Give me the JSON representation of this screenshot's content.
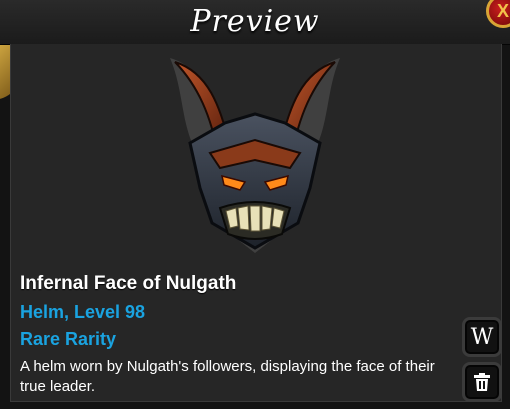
{
  "window": {
    "title": "Preview",
    "close_glyph": "X"
  },
  "item": {
    "name": "Infernal Face of Nulgath",
    "type_level": "Helm, Level 98",
    "rarity": "Rare Rarity",
    "description": "A helm worn by Nulgath's followers, displaying the face of their true leader."
  },
  "buttons": {
    "wiki_label": "W",
    "delete_icon": "trash-icon"
  },
  "colors": {
    "accent_blue": "#1aa3e0",
    "panel_bg": "#262626",
    "close_red": "#c81e1e",
    "gold": "#d8a536"
  }
}
